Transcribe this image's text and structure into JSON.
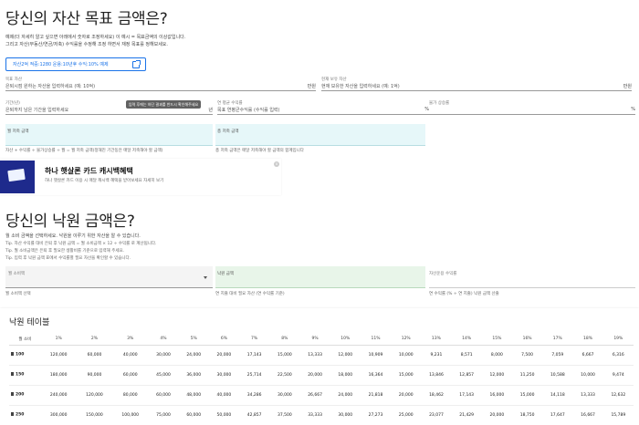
{
  "section1": {
    "title": "당신의 자산 목표 금액은?",
    "desc1": "예제(더 자세히 알고 싶으면 아래에서 숫자로 조정하세요) 이 예시 = 목표금액의 이상값입니다.",
    "desc2": "그리고 자산(부동산/연금/저축) 수익률을 수정해 조정 하면서 재정 목표를 정해보세요.",
    "example_button": "자산2억 적중:1280 운용:10년후 수익:10% 예제"
  },
  "fields_row1": {
    "goal_label": "목표 자산",
    "goal_placeholder": "은퇴시점 원하는 자산을 입력하세요 (예: 10억)",
    "goal_unit": "만원",
    "current_label": "현재 보유 자산",
    "current_placeholder": "현재 보유한 자산을 입력하세요 (예: 1억)",
    "current_unit": "만원"
  },
  "fields_row2": {
    "years_label": "기간(년)",
    "years_placeholder": "은퇴까지 남은 기간을 입력하세요",
    "years_unit": "년",
    "return_label": "연 평균 수익률",
    "return_placeholder": "목표 연평균수익률 (수익률 입력)",
    "return_unit": "%",
    "inflation_label": "물가 상승률",
    "inflation_unit": "%"
  },
  "tooltip": "입력 후에는 하단 결과를 반드시 확인해주세요",
  "results1": {
    "monthly_label": "월 저축 금액",
    "total_label": "총 저축 금액",
    "monthly_note": "자산 + 수익률 ÷ 물가상승률 ÷ 월 = 월 저축 금액(정해진 기간동안 매달 저축해야 할 금액)",
    "total_note": "총 저축 금액은 매달 저축해야 할 금액의 합계입니다"
  },
  "ad": {
    "title": "하나 햇살론 카드 캐시백혜택",
    "desc": "하나 햇살론 카드 이용 시 매달 캐시백 혜택을 받아보세요 자세히 보기",
    "close": "x"
  },
  "section2": {
    "title": "당신의 낙원 금액은?",
    "desc": "월 소비 금액을 선택하세요. 낙원을 이루기 위한 자산을 알 수 있습니다.",
    "tip1": "Tip. 자산 수익률 대비 은퇴 후 낙원 금액 = 월 소비금액 × 12 ÷ 수익률 로 계산됩니다.",
    "tip2": "Tip. 월 소비금액은 은퇴 후 필요한 생활비를 기준으로 입력해 주세요.",
    "tip3": "Tip. 입력 후 낙원 금액 표에서 수익률별 필요 자산을 확인할 수 있습니다.",
    "select_label": "월 소비액",
    "select_caption": "월 소비액 선택",
    "paradise_label": "낙원 금액",
    "paradise_caption": "연 지출 대비 필요 자산 (연 수익률 기준)",
    "rate_label": "자산운용 수익률",
    "rate_caption": "연 수익률 (% ÷ 연 지출) 낙원 금액 산출"
  },
  "table": {
    "title": "낙원 테이블",
    "headers": [
      "월 소비",
      "1%",
      "2%",
      "3%",
      "4%",
      "5%",
      "6%",
      "7%",
      "8%",
      "9%",
      "10%",
      "11%",
      "12%",
      "13%",
      "14%",
      "15%",
      "16%",
      "17%",
      "18%",
      "19%"
    ],
    "rows": [
      [
        "100",
        "120,000",
        "60,000",
        "40,000",
        "30,000",
        "24,000",
        "20,000",
        "17,143",
        "15,000",
        "13,333",
        "12,000",
        "10,909",
        "10,000",
        "9,231",
        "8,571",
        "8,000",
        "7,500",
        "7,059",
        "6,667",
        "6,316"
      ],
      [
        "150",
        "180,000",
        "90,000",
        "60,000",
        "45,000",
        "36,000",
        "30,000",
        "25,714",
        "22,500",
        "20,000",
        "18,000",
        "16,364",
        "15,000",
        "13,846",
        "12,857",
        "12,000",
        "11,250",
        "10,588",
        "10,000",
        "9,474"
      ],
      [
        "200",
        "240,000",
        "120,000",
        "80,000",
        "60,000",
        "48,000",
        "40,000",
        "34,286",
        "30,000",
        "26,667",
        "24,000",
        "21,818",
        "20,000",
        "18,462",
        "17,143",
        "16,000",
        "15,000",
        "14,118",
        "13,333",
        "12,632"
      ],
      [
        "250",
        "300,000",
        "150,000",
        "100,000",
        "75,000",
        "60,000",
        "50,000",
        "42,857",
        "37,500",
        "33,333",
        "30,000",
        "27,273",
        "25,000",
        "23,077",
        "21,429",
        "20,000",
        "18,750",
        "17,647",
        "16,667",
        "15,789"
      ]
    ]
  }
}
